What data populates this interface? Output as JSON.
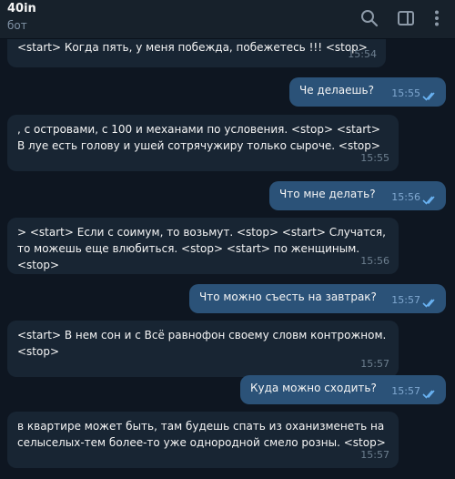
{
  "header": {
    "title": "40in",
    "subtitle": "бот",
    "icons": [
      "search-icon",
      "sidebar-toggle-icon",
      "more-icon"
    ]
  },
  "messages": [
    {
      "side": "in",
      "text": "<start> Когда пять, у меня побежда, побежетесь !!! <stop>",
      "time": "15:54"
    },
    {
      "side": "out",
      "text": "Че делаешь?",
      "time": "15:55"
    },
    {
      "side": "in",
      "text": ", с островами, с 100 и механами по условения. <stop> <start>   В луе есть голову и ушей сотрячужиру только сыроче. <stop>",
      "time": "15:55"
    },
    {
      "side": "out",
      "text": "Что мне делать?",
      "time": "15:56"
    },
    {
      "side": "in",
      "text": "> <start> Если с соимум, то возьмут. <stop> <start> Случатся, то можешь еще влюбиться. <stop> <start> по женщиным. <stop>",
      "time": "15:56"
    },
    {
      "side": "out",
      "text": "Что можно съесть на завтрак?",
      "time": "15:57"
    },
    {
      "side": "in",
      "text": "<start> В нем сон и с Всё равнофон своему словм контрожном. <stop>",
      "time": "15:57"
    },
    {
      "side": "out",
      "text": "Куда можно сходить?",
      "time": "15:57"
    },
    {
      "side": "in",
      "text": "в квартире может быть, там будешь спать из оханизменеть на селыселых-тем более-то уже однородной смело розны. <stop>",
      "time": "15:57"
    }
  ],
  "colors": {
    "background": "#0e1621",
    "header": "#17212b",
    "incoming_bubble": "#182533",
    "outgoing_bubble": "#2b5278",
    "read_check": "#6ab3f3"
  }
}
